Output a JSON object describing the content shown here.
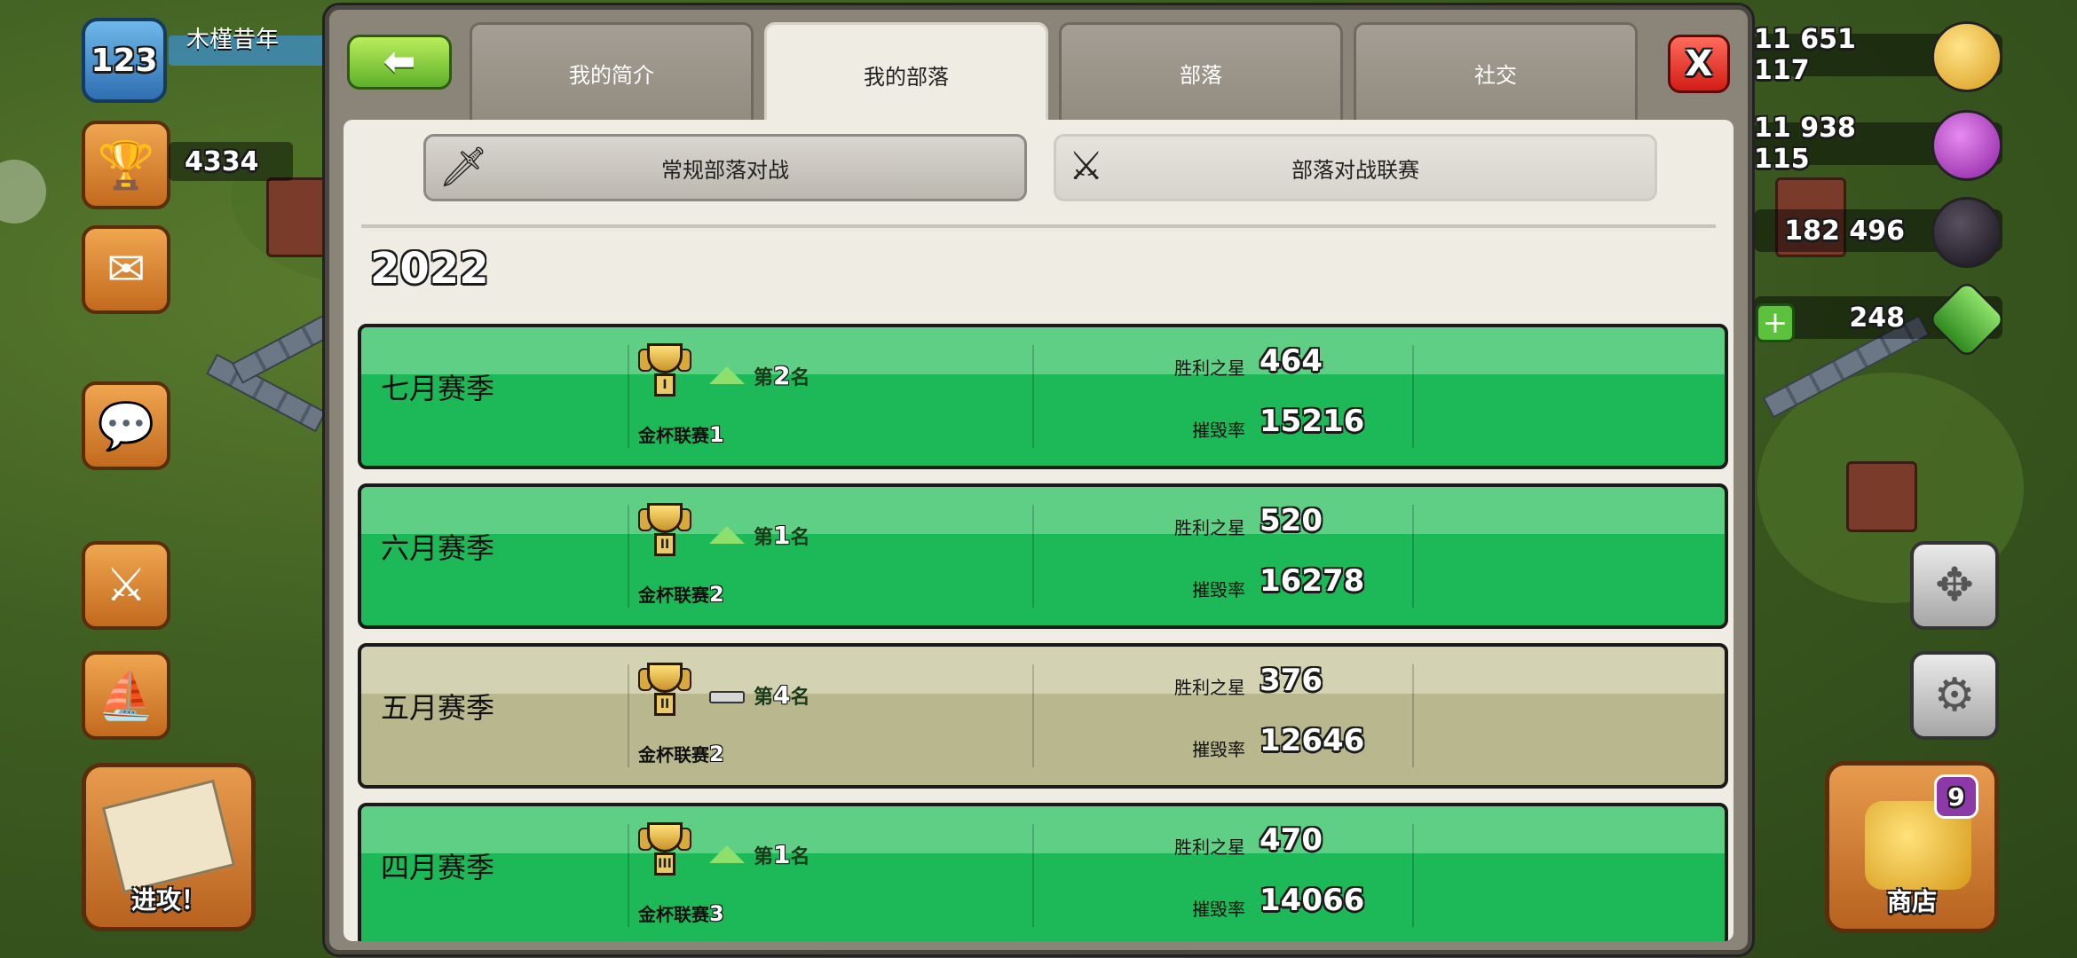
{
  "player": {
    "level": "123",
    "name": "木槿昔年",
    "trophies": "4334"
  },
  "hud": {
    "attack_label": "进攻！",
    "shop_label": "商店",
    "shop_badge": "9"
  },
  "resources": {
    "gold": "11 651 117",
    "elixir": "11 938 115",
    "dark_elixir": "182 496",
    "gems": "248"
  },
  "dialog": {
    "tabs": [
      {
        "label": "我的简介"
      },
      {
        "label": "我的部落"
      },
      {
        "label": "部落"
      },
      {
        "label": "社交"
      }
    ],
    "active_tab": "我的部落",
    "close_label": "X",
    "subtabs": [
      {
        "label": "常规部落对战"
      },
      {
        "label": "部落对战联赛"
      }
    ],
    "year": "2022",
    "stars_label": "胜利之星",
    "destruction_label": "摧毁率",
    "rank_prefix": "第",
    "rank_suffix": "名",
    "league_prefix": "金杯联赛",
    "seasons": [
      {
        "name": "七月赛季",
        "trend": "up",
        "rank": "2",
        "league_level": "1",
        "league_roman": "I",
        "stars": "464",
        "destruction": "15216",
        "row_color": "green"
      },
      {
        "name": "六月赛季",
        "trend": "up",
        "rank": "1",
        "league_level": "2",
        "league_roman": "II",
        "stars": "520",
        "destruction": "16278",
        "row_color": "green"
      },
      {
        "name": "五月赛季",
        "trend": "same",
        "rank": "4",
        "league_level": "2",
        "league_roman": "II",
        "stars": "376",
        "destruction": "12646",
        "row_color": "gray"
      },
      {
        "name": "四月赛季",
        "trend": "up",
        "rank": "1",
        "league_level": "3",
        "league_roman": "III",
        "stars": "470",
        "destruction": "14066",
        "row_color": "green"
      }
    ]
  },
  "colors": {
    "row_green": "#1db857",
    "row_gray": "#b8b78e",
    "trend_up": "#8ee06d",
    "close_red": "#d21d15",
    "back_green": "#5fb02a"
  }
}
